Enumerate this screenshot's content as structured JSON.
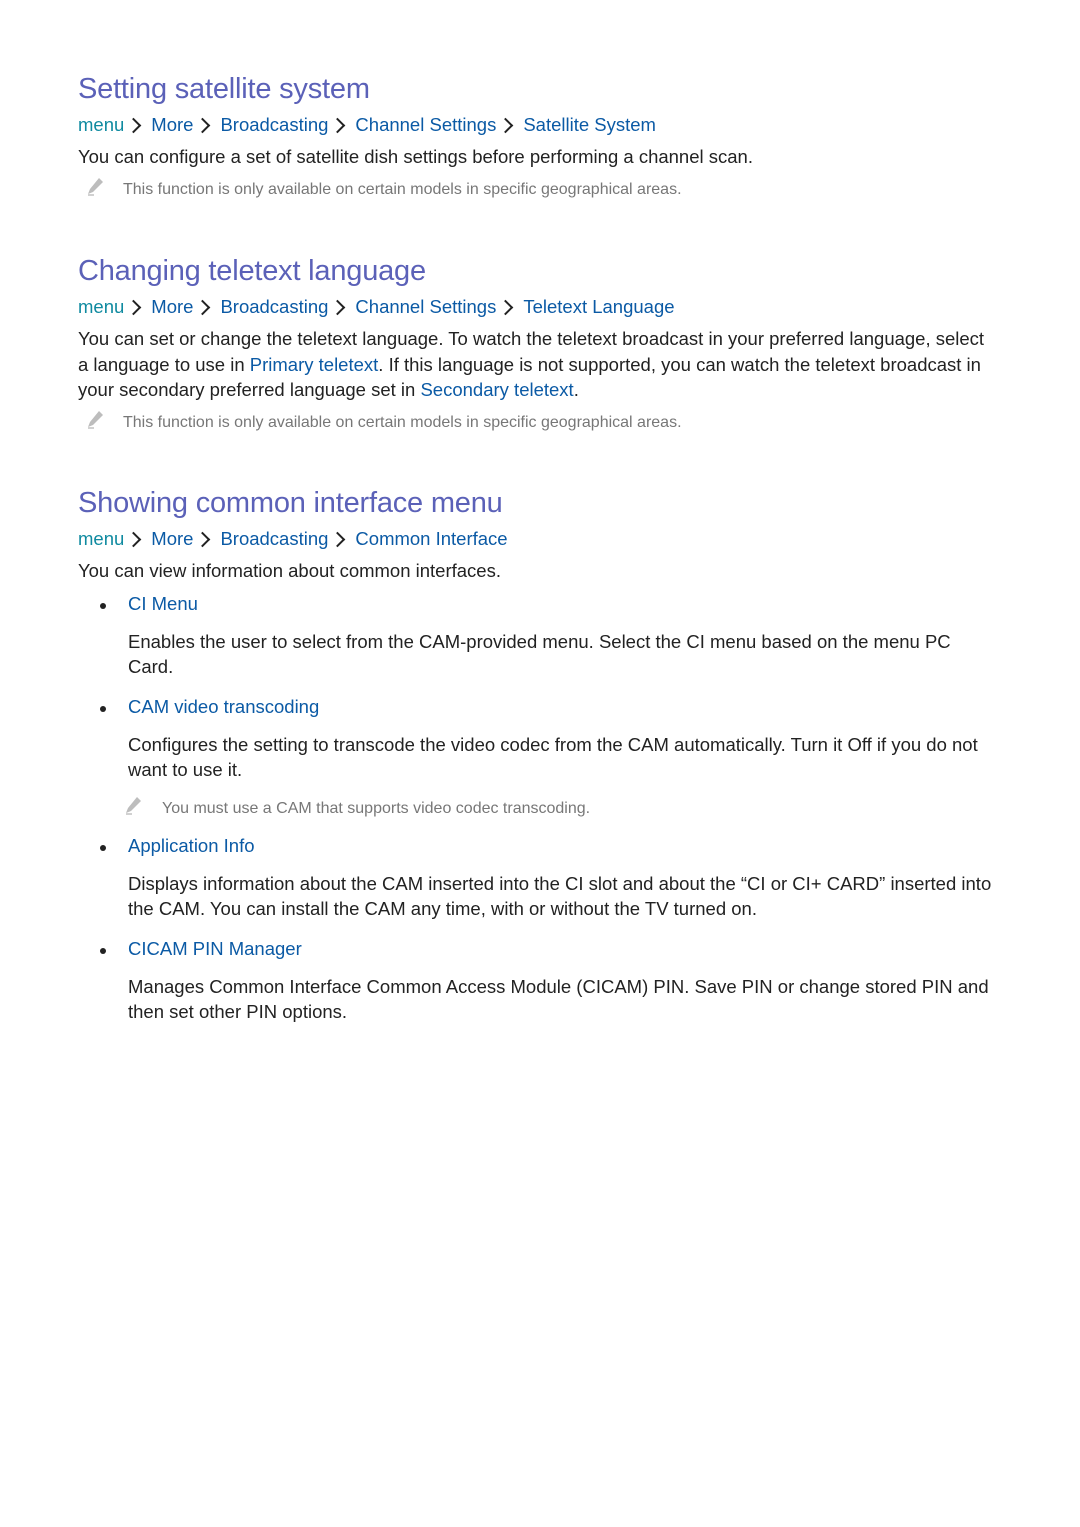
{
  "colors": {
    "heading": "#5b61b8",
    "link": "#0b5aa5",
    "menu_root": "#0f8aa0",
    "body_text": "#222222",
    "note_text": "#777777"
  },
  "sections": [
    {
      "title": "Setting satellite system",
      "breadcrumb": [
        "menu",
        "More",
        "Broadcasting",
        "Channel Settings",
        "Satellite System"
      ],
      "body": "You can configure a set of satellite dish settings before performing a channel scan.",
      "note": {
        "icon": "pencil-icon",
        "text": "This function is only available on certain models in specific geographical areas."
      }
    },
    {
      "title": "Changing teletext language",
      "breadcrumb": [
        "menu",
        "More",
        "Broadcasting",
        "Channel Settings",
        "Teletext Language"
      ],
      "body_parts": [
        {
          "text": "You can set or change the teletext language. To watch the teletext broadcast in your preferred language, select a language to use in "
        },
        {
          "text": "Primary teletext",
          "link": true
        },
        {
          "text": ". If this language is not supported, you can watch the teletext broadcast in your secondary preferred language set in "
        },
        {
          "text": "Secondary teletext",
          "link": true
        },
        {
          "text": "."
        }
      ],
      "note": {
        "icon": "pencil-icon",
        "text": "This function is only available on certain models in specific geographical areas."
      }
    },
    {
      "title": "Showing common interface menu",
      "breadcrumb": [
        "menu",
        "More",
        "Broadcasting",
        "Common Interface"
      ],
      "body": "You can view information about common interfaces.",
      "items": [
        {
          "title": "CI Menu",
          "desc": "Enables the user to select from the CAM-provided menu. Select the CI menu based on the menu PC Card."
        },
        {
          "title": "CAM video transcoding",
          "desc": "Configures the setting to transcode the video codec from the CAM automatically. Turn it Off if you do not want to use it.",
          "note": {
            "icon": "pencil-icon",
            "text": "You must use a CAM that supports video codec transcoding."
          }
        },
        {
          "title": "Application Info",
          "desc": "Displays information about the CAM inserted into the CI slot and about the “CI or CI+ CARD” inserted into the CAM. You can install the CAM any time, with or without the TV turned on."
        },
        {
          "title": "CICAM PIN Manager",
          "desc": "Manages Common Interface Common Access Module (CICAM) PIN. Save PIN or change stored PIN and then set other PIN options."
        }
      ]
    }
  ]
}
